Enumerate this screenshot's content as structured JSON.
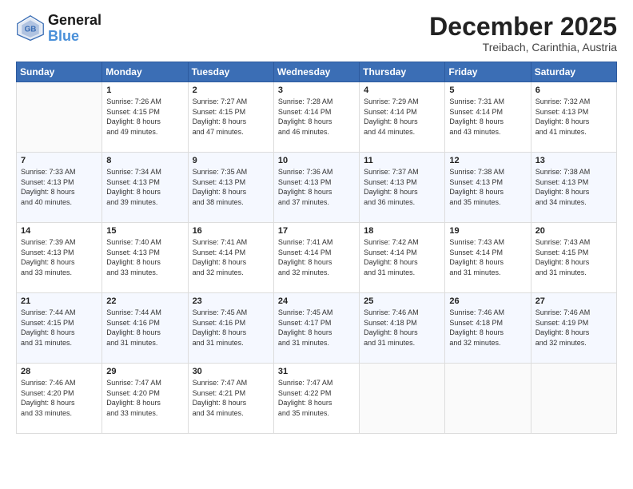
{
  "header": {
    "logo_line1": "General",
    "logo_line2": "Blue",
    "month": "December 2025",
    "location": "Treibach, Carinthia, Austria"
  },
  "days_of_week": [
    "Sunday",
    "Monday",
    "Tuesday",
    "Wednesday",
    "Thursday",
    "Friday",
    "Saturday"
  ],
  "weeks": [
    [
      {
        "num": "",
        "info": ""
      },
      {
        "num": "1",
        "info": "Sunrise: 7:26 AM\nSunset: 4:15 PM\nDaylight: 8 hours\nand 49 minutes."
      },
      {
        "num": "2",
        "info": "Sunrise: 7:27 AM\nSunset: 4:15 PM\nDaylight: 8 hours\nand 47 minutes."
      },
      {
        "num": "3",
        "info": "Sunrise: 7:28 AM\nSunset: 4:14 PM\nDaylight: 8 hours\nand 46 minutes."
      },
      {
        "num": "4",
        "info": "Sunrise: 7:29 AM\nSunset: 4:14 PM\nDaylight: 8 hours\nand 44 minutes."
      },
      {
        "num": "5",
        "info": "Sunrise: 7:31 AM\nSunset: 4:14 PM\nDaylight: 8 hours\nand 43 minutes."
      },
      {
        "num": "6",
        "info": "Sunrise: 7:32 AM\nSunset: 4:13 PM\nDaylight: 8 hours\nand 41 minutes."
      }
    ],
    [
      {
        "num": "7",
        "info": "Sunrise: 7:33 AM\nSunset: 4:13 PM\nDaylight: 8 hours\nand 40 minutes."
      },
      {
        "num": "8",
        "info": "Sunrise: 7:34 AM\nSunset: 4:13 PM\nDaylight: 8 hours\nand 39 minutes."
      },
      {
        "num": "9",
        "info": "Sunrise: 7:35 AM\nSunset: 4:13 PM\nDaylight: 8 hours\nand 38 minutes."
      },
      {
        "num": "10",
        "info": "Sunrise: 7:36 AM\nSunset: 4:13 PM\nDaylight: 8 hours\nand 37 minutes."
      },
      {
        "num": "11",
        "info": "Sunrise: 7:37 AM\nSunset: 4:13 PM\nDaylight: 8 hours\nand 36 minutes."
      },
      {
        "num": "12",
        "info": "Sunrise: 7:38 AM\nSunset: 4:13 PM\nDaylight: 8 hours\nand 35 minutes."
      },
      {
        "num": "13",
        "info": "Sunrise: 7:38 AM\nSunset: 4:13 PM\nDaylight: 8 hours\nand 34 minutes."
      }
    ],
    [
      {
        "num": "14",
        "info": "Sunrise: 7:39 AM\nSunset: 4:13 PM\nDaylight: 8 hours\nand 33 minutes."
      },
      {
        "num": "15",
        "info": "Sunrise: 7:40 AM\nSunset: 4:13 PM\nDaylight: 8 hours\nand 33 minutes."
      },
      {
        "num": "16",
        "info": "Sunrise: 7:41 AM\nSunset: 4:14 PM\nDaylight: 8 hours\nand 32 minutes."
      },
      {
        "num": "17",
        "info": "Sunrise: 7:41 AM\nSunset: 4:14 PM\nDaylight: 8 hours\nand 32 minutes."
      },
      {
        "num": "18",
        "info": "Sunrise: 7:42 AM\nSunset: 4:14 PM\nDaylight: 8 hours\nand 31 minutes."
      },
      {
        "num": "19",
        "info": "Sunrise: 7:43 AM\nSunset: 4:14 PM\nDaylight: 8 hours\nand 31 minutes."
      },
      {
        "num": "20",
        "info": "Sunrise: 7:43 AM\nSunset: 4:15 PM\nDaylight: 8 hours\nand 31 minutes."
      }
    ],
    [
      {
        "num": "21",
        "info": "Sunrise: 7:44 AM\nSunset: 4:15 PM\nDaylight: 8 hours\nand 31 minutes."
      },
      {
        "num": "22",
        "info": "Sunrise: 7:44 AM\nSunset: 4:16 PM\nDaylight: 8 hours\nand 31 minutes."
      },
      {
        "num": "23",
        "info": "Sunrise: 7:45 AM\nSunset: 4:16 PM\nDaylight: 8 hours\nand 31 minutes."
      },
      {
        "num": "24",
        "info": "Sunrise: 7:45 AM\nSunset: 4:17 PM\nDaylight: 8 hours\nand 31 minutes."
      },
      {
        "num": "25",
        "info": "Sunrise: 7:46 AM\nSunset: 4:18 PM\nDaylight: 8 hours\nand 31 minutes."
      },
      {
        "num": "26",
        "info": "Sunrise: 7:46 AM\nSunset: 4:18 PM\nDaylight: 8 hours\nand 32 minutes."
      },
      {
        "num": "27",
        "info": "Sunrise: 7:46 AM\nSunset: 4:19 PM\nDaylight: 8 hours\nand 32 minutes."
      }
    ],
    [
      {
        "num": "28",
        "info": "Sunrise: 7:46 AM\nSunset: 4:20 PM\nDaylight: 8 hours\nand 33 minutes."
      },
      {
        "num": "29",
        "info": "Sunrise: 7:47 AM\nSunset: 4:20 PM\nDaylight: 8 hours\nand 33 minutes."
      },
      {
        "num": "30",
        "info": "Sunrise: 7:47 AM\nSunset: 4:21 PM\nDaylight: 8 hours\nand 34 minutes."
      },
      {
        "num": "31",
        "info": "Sunrise: 7:47 AM\nSunset: 4:22 PM\nDaylight: 8 hours\nand 35 minutes."
      },
      {
        "num": "",
        "info": ""
      },
      {
        "num": "",
        "info": ""
      },
      {
        "num": "",
        "info": ""
      }
    ]
  ]
}
